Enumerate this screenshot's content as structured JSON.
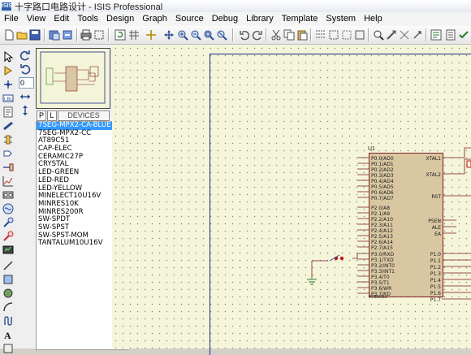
{
  "window": {
    "icon_text": "ISIS",
    "title": "十字路口电路设计 - ISIS Professional"
  },
  "menu": [
    "File",
    "View",
    "Edit",
    "Tools",
    "Design",
    "Graph",
    "Source",
    "Debug",
    "Library",
    "Template",
    "System",
    "Help"
  ],
  "side": {
    "angle_value": "0",
    "tab_p": "P",
    "tab_l": "L",
    "devices_header": "DEVICES"
  },
  "devices": [
    "7SEG-MPX2-CA-BLUE",
    "7SEG-MPX2-CC",
    "AT89C51",
    "CAP-ELEC",
    "CERAMIC27P",
    "CRYSTAL",
    "LED-GREEN",
    "LED-RED",
    "LED-YELLOW",
    "MINELECT10U16V",
    "MINRES10K",
    "MINRES200R",
    "SW-SPDT",
    "SW-SPST",
    "SW-SPST-MOM",
    "TANTALUM10U16V"
  ],
  "selected_device": "7SEG-MPX2-CA-BLUE",
  "schematic": {
    "ref": "U1",
    "part": "AT89C51",
    "left_pins": [
      "P0.0/AD0",
      "P0.1/AD1",
      "P0.2/AD2",
      "P0.3/AD3",
      "P0.4/AD4",
      "P0.5/AD5",
      "P0.6/AD6",
      "P0.7/AD7",
      "P2.0/A8",
      "P2.1/A9",
      "P2.2/A10",
      "P2.3/A11",
      "P2.4/A12",
      "P2.5/A13",
      "P2.6/A14",
      "P2.7/A15",
      "P3.0/RXD",
      "P3.1/TXD",
      "P3.2/INT0",
      "P3.3/INT1",
      "P3.4/T0",
      "P3.5/T1",
      "P3.6/WR",
      "P3.7/RD"
    ],
    "right_pins": [
      "XTAL1",
      "XTAL2",
      "RST",
      "PSEN",
      "ALE",
      "EA",
      "P1.0",
      "P1.1",
      "P1.2",
      "P1.3",
      "P1.4",
      "P1.5",
      "P1.6",
      "P1.7"
    ]
  },
  "colors": {
    "canvas": "#f5f5da",
    "sheet_border": "#1b2a8c",
    "chip_fill": "#d9c7a2",
    "chip_border": "#7a1f1f",
    "wire": "#7a1f1f",
    "selection": "#3399ff"
  }
}
